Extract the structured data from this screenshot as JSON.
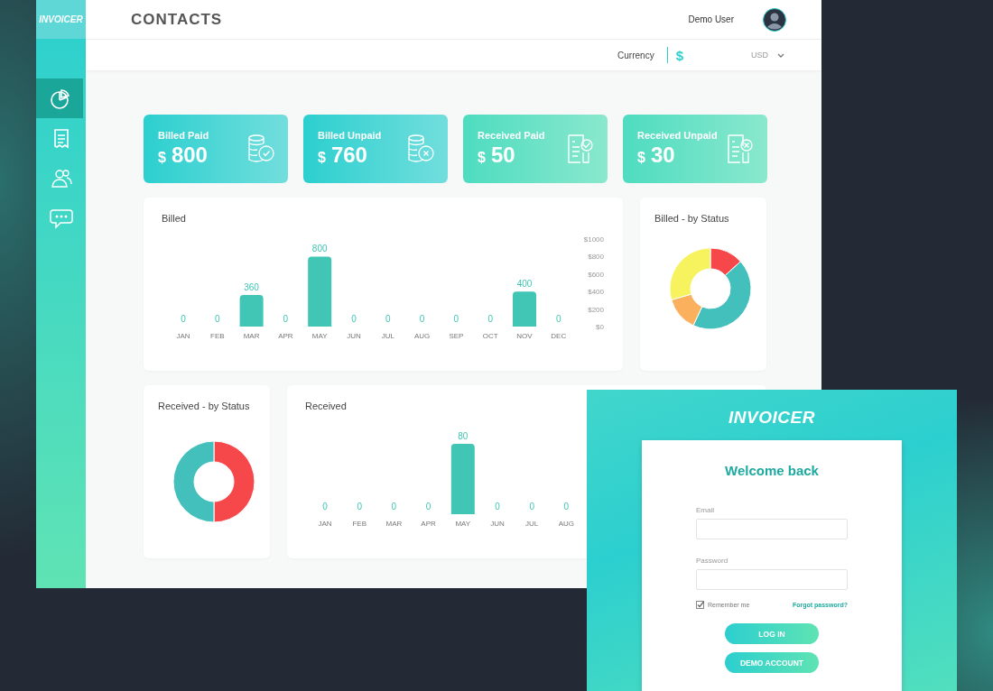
{
  "dashboard": {
    "sidebar": {
      "logo": "INVOICER",
      "items": [
        {
          "selected": true
        },
        {
          "selected": false
        },
        {
          "selected": false
        },
        {
          "selected": false
        }
      ]
    },
    "header": {
      "title": "CONTACTS",
      "user": "Demo User"
    },
    "currency": {
      "label": "Currency",
      "symbol": "$",
      "value": "USD"
    },
    "cards": [
      {
        "label": "Billed Paid",
        "currency": "$",
        "amount": "800",
        "kind": "billed",
        "paid": true
      },
      {
        "label": "Billed Unpaid",
        "currency": "$",
        "amount": "760",
        "kind": "billed",
        "paid": false
      },
      {
        "label": "Received Paid",
        "currency": "$",
        "amount": "50",
        "kind": "received",
        "paid": true
      },
      {
        "label": "Received Unpaid",
        "currency": "$",
        "amount": "30",
        "kind": "received",
        "paid": false
      }
    ],
    "billed": {
      "title": "Billed",
      "chart_data": {
        "type": "bar",
        "categories": [
          "JAN",
          "FEB",
          "MAR",
          "APR",
          "MAY",
          "JUN",
          "JUL",
          "AUG",
          "SEP",
          "OCT",
          "NOV",
          "DEC"
        ],
        "values": [
          0,
          0,
          360,
          0,
          800,
          0,
          0,
          0,
          0,
          0,
          400,
          0
        ],
        "ylim": [
          0,
          1000
        ],
        "yticks": [
          {
            "value": 0,
            "label": "$0"
          },
          {
            "value": 200,
            "label": "$200"
          },
          {
            "value": 400,
            "label": "$400"
          },
          {
            "value": 600,
            "label": "$600"
          },
          {
            "value": 800,
            "label": "$800"
          },
          {
            "value": 1000,
            "label": "$1000"
          }
        ],
        "data_labels": true
      }
    },
    "billed_status": {
      "title": "Billed - by Status"
    },
    "received_status": {
      "title": "Received - by Status"
    },
    "received": {
      "title": "Received",
      "chart_data": {
        "type": "bar",
        "categories": [
          "JAN",
          "FEB",
          "MAR",
          "APR",
          "MAY",
          "JUN",
          "JUL",
          "AUG"
        ],
        "values": [
          0,
          0,
          0,
          0,
          80,
          0,
          0,
          0
        ],
        "data_labels": true
      }
    }
  },
  "login": {
    "logo": "INVOICER",
    "heading": "Welcome back",
    "email": {
      "label": "Email"
    },
    "password": {
      "label": "Password"
    },
    "remember": {
      "label": "Remember me",
      "checked": true
    },
    "forgot": "Forgot password?",
    "buttons": [
      "LOG IN",
      "DEMO ACCOUNT"
    ]
  }
}
